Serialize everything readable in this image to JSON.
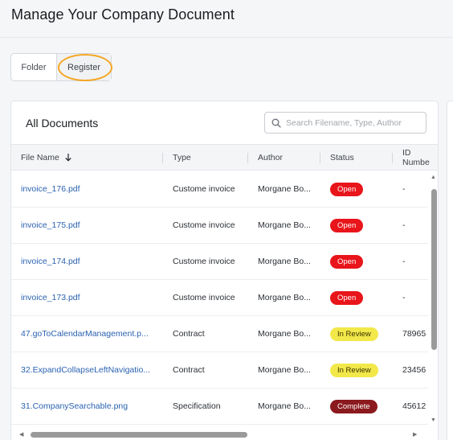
{
  "page": {
    "title": "Manage Your Company Document"
  },
  "view_toggle": {
    "folder_label": "Folder",
    "register_label": "Register",
    "selected": "Register",
    "highlight_color": "#f5a623"
  },
  "documents": {
    "title": "All Documents",
    "search_placeholder": "Search Filename, Type, Author",
    "columns": {
      "file_name": "File Name",
      "type": "Type",
      "author": "Author",
      "status": "Status",
      "id_number": "ID Numbe"
    },
    "rows": [
      {
        "file": "invoice_176.pdf",
        "type": "Custome invoice",
        "author": "Morgane Bo...",
        "status": "Open",
        "status_kind": "open",
        "id": "-"
      },
      {
        "file": "invoice_175.pdf",
        "type": "Custome invoice",
        "author": "Morgane Bo...",
        "status": "Open",
        "status_kind": "open",
        "id": "-"
      },
      {
        "file": "invoice_174.pdf",
        "type": "Custome invoice",
        "author": "Morgane Bo...",
        "status": "Open",
        "status_kind": "open",
        "id": "-"
      },
      {
        "file": "invoice_173.pdf",
        "type": "Custome invoice",
        "author": "Morgane Bo...",
        "status": "Open",
        "status_kind": "open",
        "id": "-"
      },
      {
        "file": "47.goToCalendarManagement.p...",
        "type": "Contract",
        "author": "Morgane Bo...",
        "status": "In Review",
        "status_kind": "review",
        "id": "78965"
      },
      {
        "file": "32.ExpandCollapseLeftNavigatio...",
        "type": "Contract",
        "author": "Morgane Bo...",
        "status": "In Review",
        "status_kind": "review",
        "id": "23456"
      },
      {
        "file": "31.CompanySearchable.png",
        "type": "Specification",
        "author": "Morgane Bo...",
        "status": "Complete",
        "status_kind": "complete",
        "id": "45612"
      }
    ]
  },
  "colors": {
    "link": "#2b62b0",
    "open": "#e8151b",
    "in_review": "#f2e84a",
    "complete": "#8b1a1e"
  },
  "icons": {
    "search": "search-icon",
    "sort": "arrow-down-icon"
  }
}
